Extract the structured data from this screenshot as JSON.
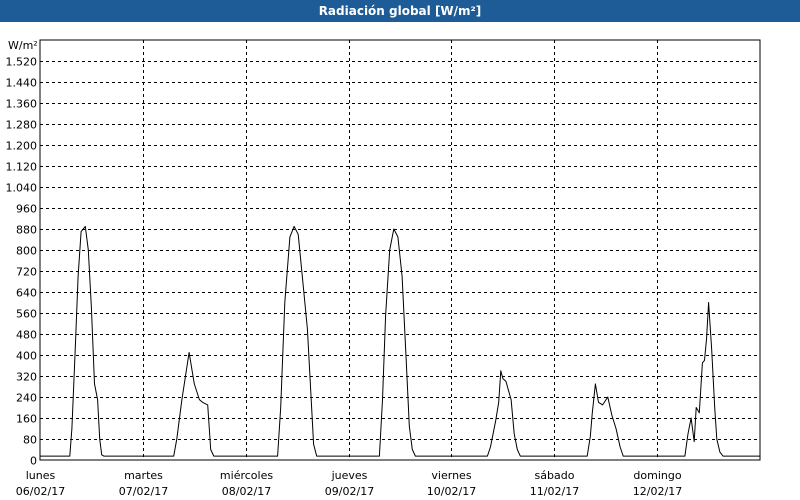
{
  "window": {
    "title": "Radiación global [W/m²]"
  },
  "chart_data": {
    "type": "line",
    "title": "Radiación global [W/m²]",
    "ylabel": "W/m²",
    "xlabel": "",
    "ylim": [
      0,
      1600
    ],
    "yticks": [
      0,
      80,
      160,
      240,
      320,
      400,
      480,
      560,
      640,
      720,
      800,
      880,
      960,
      1040,
      1120,
      1200,
      1280,
      1360,
      1440,
      1520
    ],
    "ytick_labels": [
      "0",
      "80",
      "160",
      "240",
      "320",
      "400",
      "480",
      "560",
      "640",
      "720",
      "800",
      "880",
      "960",
      "1.040",
      "1.120",
      "1.200",
      "1.280",
      "1.360",
      "1.440",
      "1.520"
    ],
    "xlim": [
      0,
      7
    ],
    "x_unit": "days since lunes 06/02/17 00:00",
    "xtick_days": [
      "lunes",
      "martes",
      "miércoles",
      "jueves",
      "viernes",
      "sábado",
      "domingo"
    ],
    "xtick_dates": [
      "06/02/17",
      "07/02/17",
      "08/02/17",
      "09/02/17",
      "10/02/17",
      "11/02/17",
      "12/02/17"
    ],
    "grid": true,
    "series": [
      {
        "name": "Radiación global",
        "color": "#000000",
        "points": [
          [
            0.0,
            15
          ],
          [
            0.29,
            15
          ],
          [
            0.31,
            120
          ],
          [
            0.34,
            400
          ],
          [
            0.37,
            700
          ],
          [
            0.4,
            870
          ],
          [
            0.44,
            890
          ],
          [
            0.47,
            800
          ],
          [
            0.5,
            580
          ],
          [
            0.53,
            290
          ],
          [
            0.56,
            230
          ],
          [
            0.58,
            80
          ],
          [
            0.6,
            20
          ],
          [
            0.62,
            15
          ],
          [
            1.0,
            15
          ],
          [
            1.3,
            15
          ],
          [
            1.33,
            80
          ],
          [
            1.38,
            230
          ],
          [
            1.45,
            410
          ],
          [
            1.5,
            290
          ],
          [
            1.55,
            230
          ],
          [
            1.58,
            220
          ],
          [
            1.63,
            210
          ],
          [
            1.66,
            40
          ],
          [
            1.69,
            15
          ],
          [
            2.0,
            15
          ],
          [
            2.31,
            15
          ],
          [
            2.34,
            200
          ],
          [
            2.38,
            600
          ],
          [
            2.43,
            850
          ],
          [
            2.47,
            890
          ],
          [
            2.51,
            860
          ],
          [
            2.55,
            700
          ],
          [
            2.6,
            500
          ],
          [
            2.63,
            280
          ],
          [
            2.66,
            60
          ],
          [
            2.69,
            15
          ],
          [
            3.0,
            15
          ],
          [
            3.3,
            15
          ],
          [
            3.33,
            230
          ],
          [
            3.36,
            550
          ],
          [
            3.4,
            800
          ],
          [
            3.44,
            880
          ],
          [
            3.48,
            850
          ],
          [
            3.52,
            700
          ],
          [
            3.56,
            380
          ],
          [
            3.59,
            130
          ],
          [
            3.62,
            40
          ],
          [
            3.65,
            15
          ],
          [
            4.0,
            15
          ],
          [
            4.35,
            15
          ],
          [
            4.38,
            50
          ],
          [
            4.43,
            150
          ],
          [
            4.46,
            220
          ],
          [
            4.48,
            340
          ],
          [
            4.5,
            310
          ],
          [
            4.53,
            300
          ],
          [
            4.58,
            230
          ],
          [
            4.61,
            100
          ],
          [
            4.64,
            40
          ],
          [
            4.67,
            15
          ],
          [
            5.0,
            15
          ],
          [
            5.32,
            15
          ],
          [
            5.35,
            90
          ],
          [
            5.37,
            180
          ],
          [
            5.4,
            290
          ],
          [
            5.43,
            220
          ],
          [
            5.47,
            210
          ],
          [
            5.52,
            240
          ],
          [
            5.56,
            170
          ],
          [
            5.6,
            120
          ],
          [
            5.64,
            50
          ],
          [
            5.67,
            15
          ],
          [
            6.0,
            15
          ],
          [
            6.27,
            15
          ],
          [
            6.3,
            100
          ],
          [
            6.33,
            160
          ],
          [
            6.36,
            70
          ],
          [
            6.38,
            200
          ],
          [
            6.41,
            180
          ],
          [
            6.44,
            370
          ],
          [
            6.46,
            380
          ],
          [
            6.48,
            460
          ],
          [
            6.5,
            600
          ],
          [
            6.53,
            420
          ],
          [
            6.56,
            200
          ],
          [
            6.58,
            80
          ],
          [
            6.61,
            30
          ],
          [
            6.64,
            15
          ],
          [
            7.0,
            15
          ]
        ]
      }
    ]
  }
}
